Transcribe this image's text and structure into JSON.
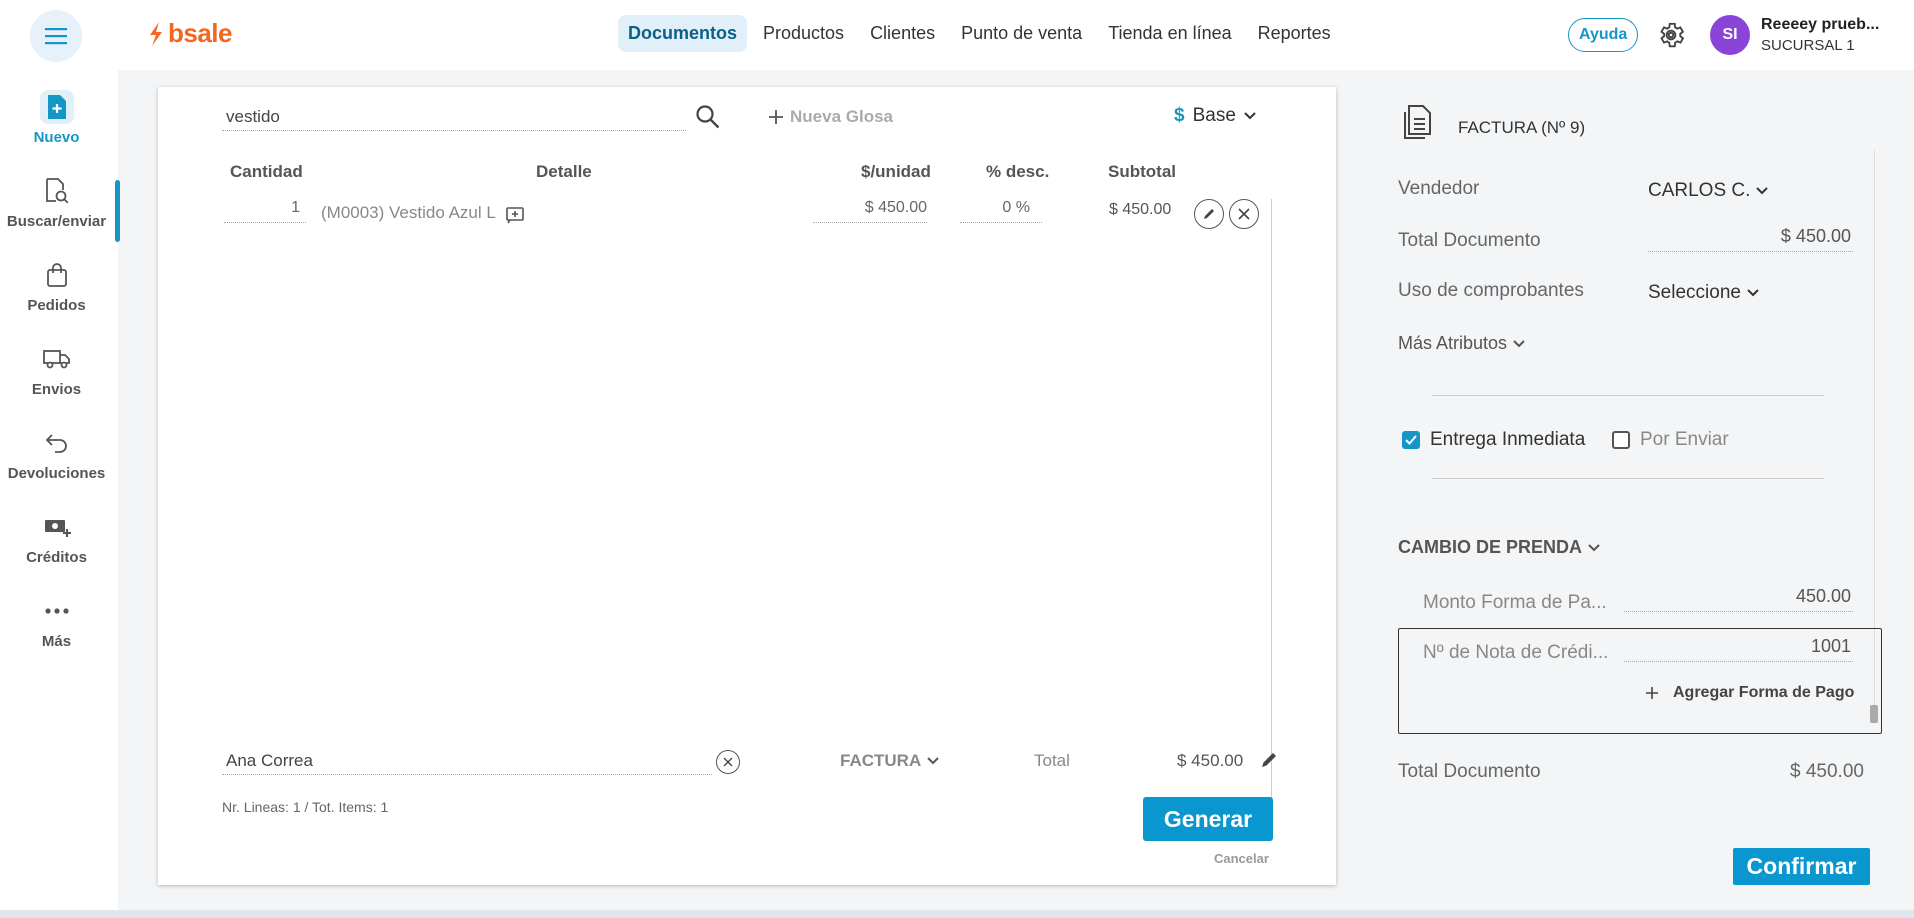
{
  "topbar": {
    "logo_text": "bsale",
    "nav": [
      {
        "label": "Documentos",
        "active": true
      },
      {
        "label": "Productos",
        "active": false
      },
      {
        "label": "Clientes",
        "active": false
      },
      {
        "label": "Punto de venta",
        "active": false
      },
      {
        "label": "Tienda en línea",
        "active": false
      },
      {
        "label": "Reportes",
        "active": false
      }
    ],
    "help_label": "Ayuda",
    "avatar_initials": "SI",
    "user_name": "Reeeey prueb...",
    "user_branch": "SUCURSAL 1"
  },
  "sidebar": {
    "items": [
      {
        "label": "Nuevo",
        "icon": "new-document-icon",
        "active": true
      },
      {
        "label": "Buscar/enviar",
        "icon": "search-document-icon",
        "active": false
      },
      {
        "label": "Pedidos",
        "icon": "shopping-bag-icon",
        "active": false
      },
      {
        "label": "Envios",
        "icon": "truck-icon",
        "active": false
      },
      {
        "label": "Devoluciones",
        "icon": "return-arrow-icon",
        "active": false
      },
      {
        "label": "Créditos",
        "icon": "cash-plus-icon",
        "active": false
      },
      {
        "label": "Más",
        "icon": "more-dots-icon",
        "active": false
      }
    ]
  },
  "document": {
    "search_value": "vestido",
    "new_glosa_label": "Nueva Glosa",
    "currency_symbol": "$",
    "currency_label": "Base",
    "columns": {
      "quantity": "Cantidad",
      "detail": "Detalle",
      "unit_price": "$/unidad",
      "discount": "% desc.",
      "subtotal": "Subtotal"
    },
    "rows": [
      {
        "quantity": "1",
        "detail": "(M0003) Vestido Azul L",
        "unit_price": "$ 450.00",
        "discount": "0 %",
        "subtotal": "$ 450.00"
      }
    ],
    "client": "Ana Correa",
    "doc_type": "FACTURA",
    "total_label": "Total",
    "total_value": "$ 450.00",
    "lines_info": "Nr. Lineas: 1 / Tot. Items: 1",
    "generate_label": "Generar",
    "cancel_label": "Cancelar"
  },
  "right_panel": {
    "title": "FACTURA (Nº 9)",
    "seller_label": "Vendedor",
    "seller_value": "CARLOS C.",
    "total_doc_label": "Total Documento",
    "total_doc_value": "$ 450.00",
    "vouchers_label": "Uso de comprobantes",
    "vouchers_value": "Seleccione",
    "more_attrs_label": "Más Atributos",
    "immediate_delivery_label": "Entrega Inmediata",
    "immediate_delivery_checked": true,
    "to_ship_label": "Por Enviar",
    "to_ship_checked": false,
    "payment_section_label": "CAMBIO DE PRENDA",
    "payment_amount_label": "Monto Forma de Pa...",
    "payment_amount_value": "450.00",
    "credit_note_label": "Nº de Nota de Crédi...",
    "credit_note_value": "1001",
    "add_payment_label": "Agregar Forma de Pago",
    "bottom_total_label": "Total Documento",
    "bottom_total_value": "$ 450.00",
    "confirm_label": "Confirmar"
  },
  "colors": {
    "accent": "#1497c6",
    "brand": "#f26722",
    "avatar": "#8b44d8",
    "button": "#0a96cf"
  }
}
